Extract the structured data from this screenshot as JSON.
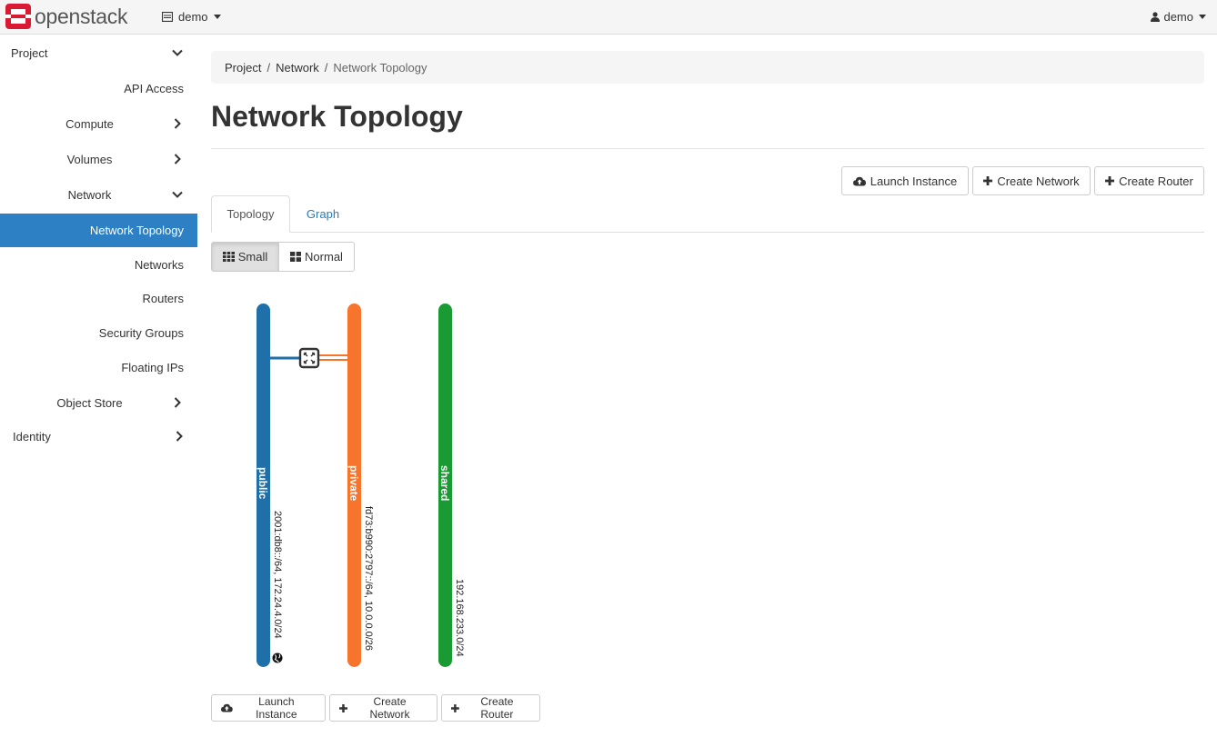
{
  "brand": {
    "name": "openstack",
    "logo_color": "#da1a32"
  },
  "header": {
    "project": "demo",
    "user": "demo"
  },
  "sidebar": {
    "items": [
      {
        "label": "Project",
        "chevron": "down"
      },
      {
        "label": "API Access"
      },
      {
        "label": "Compute",
        "chevron": "right"
      },
      {
        "label": "Volumes",
        "chevron": "right"
      },
      {
        "label": "Network",
        "chevron": "down"
      },
      {
        "label": "Network Topology",
        "active": true
      },
      {
        "label": "Networks"
      },
      {
        "label": "Routers"
      },
      {
        "label": "Security Groups"
      },
      {
        "label": "Floating IPs"
      },
      {
        "label": "Object Store",
        "chevron": "right"
      },
      {
        "label": "Identity",
        "chevron": "right"
      }
    ],
    "active_color": "#2d80c4"
  },
  "breadcrumb": {
    "items": [
      "Project",
      "Network"
    ],
    "current": "Network Topology"
  },
  "page_title": "Network Topology",
  "actions": {
    "launch_instance": "Launch Instance",
    "create_network": "Create Network",
    "create_router": "Create Router"
  },
  "tabs": [
    {
      "label": "Topology",
      "active": true
    },
    {
      "label": "Graph"
    }
  ],
  "view_toggle": {
    "small": "Small",
    "normal": "Normal",
    "selected": "small"
  },
  "topology": {
    "networks": [
      {
        "name": "public",
        "cidr": "2001:db8::/64, 172.24.4.0/24",
        "color": "#1f6fa8",
        "external": true
      },
      {
        "name": "private",
        "cidr": "fd73:b990:2797::/64, 10.0.0.0/26",
        "color": "#f7742c"
      },
      {
        "name": "shared",
        "cidr": "192.168.233.0/24",
        "color": "#1a9a33"
      }
    ],
    "router_icon": "router-icon",
    "external_icon": "globe-icon"
  }
}
